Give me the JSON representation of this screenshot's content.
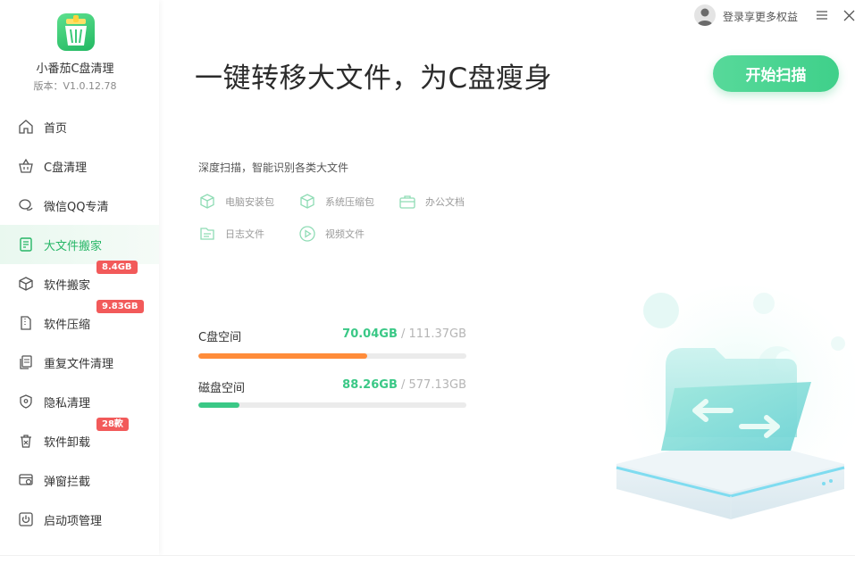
{
  "app": {
    "name": "小番茄C盘清理",
    "version": "版本：V1.0.12.78"
  },
  "topbar": {
    "login_text": "登录享更多权益"
  },
  "sidebar": {
    "items": [
      {
        "label": "首页",
        "icon": "home-icon",
        "badge": ""
      },
      {
        "label": "C盘清理",
        "icon": "basket-icon",
        "badge": ""
      },
      {
        "label": "微信QQ专清",
        "icon": "chat-icon",
        "badge": ""
      },
      {
        "label": "大文件搬家",
        "icon": "bigfile-icon",
        "badge": "",
        "active": true
      },
      {
        "label": "软件搬家",
        "icon": "box-icon",
        "badge": "8.4GB"
      },
      {
        "label": "软件压缩",
        "icon": "zip-icon",
        "badge": "9.83GB"
      },
      {
        "label": "重复文件清理",
        "icon": "duplicate-icon",
        "badge": ""
      },
      {
        "label": "隐私清理",
        "icon": "shield-icon",
        "badge": ""
      },
      {
        "label": "软件卸载",
        "icon": "trash-icon",
        "badge": "28款"
      },
      {
        "label": "弹窗拦截",
        "icon": "popup-icon",
        "badge": ""
      },
      {
        "label": "启动项管理",
        "icon": "power-icon",
        "badge": ""
      }
    ]
  },
  "main": {
    "headline": "一键转移大文件，为C盘瘦身",
    "scan_button": "开始扫描",
    "description": "深度扫描，智能识别各类大文件",
    "categories": [
      {
        "label": "电脑安装包",
        "icon": "package-icon"
      },
      {
        "label": "系统压缩包",
        "icon": "archive-icon"
      },
      {
        "label": "办公文档",
        "icon": "briefcase-icon"
      },
      {
        "label": "日志文件",
        "icon": "log-icon"
      },
      {
        "label": "视频文件",
        "icon": "video-icon"
      }
    ],
    "disks": [
      {
        "label": "C盘空间",
        "used": "70.04GB",
        "separator": " / ",
        "total": "111.37GB",
        "used_fraction": 0.629,
        "color": "#ff8c3a"
      },
      {
        "label": "磁盘空间",
        "used": "88.26GB",
        "separator": " / ",
        "total": "577.13GB",
        "used_fraction": 0.153,
        "color": "#3ac886"
      }
    ]
  },
  "colors": {
    "accent": "#26b666",
    "badge": "#f25a5a"
  }
}
